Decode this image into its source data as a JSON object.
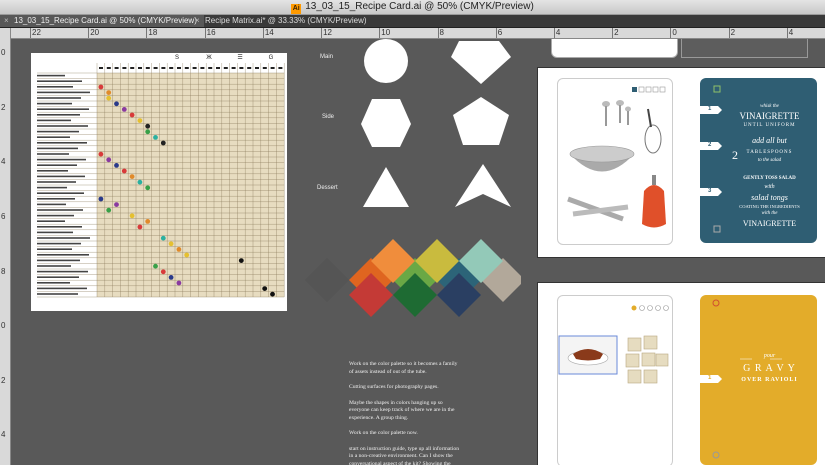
{
  "window": {
    "title": "13_03_15_Recipe Card.ai @ 50% (CMYK/Preview)",
    "app_icon": "Ai"
  },
  "tabs": [
    {
      "label": "13_03_15_Recipe Card.ai @ 50% (CMYK/Preview)",
      "close": "×",
      "active": true
    },
    {
      "label": "Recipe Matrix.ai* @ 33.33% (CMYK/Preview)",
      "close": "×",
      "active": false
    }
  ],
  "ruler_top": [
    "22",
    "20",
    "18",
    "16",
    "14",
    "12",
    "10",
    "8",
    "6",
    "4",
    "2",
    "0",
    "2",
    "4"
  ],
  "ruler_left": [
    "0",
    "2",
    "4",
    "6",
    "8",
    "0",
    "2",
    "4"
  ],
  "matrix": {
    "header_symbols": [
      "S",
      "Ж",
      "☰",
      "G"
    ],
    "dots": [
      {
        "row": 2,
        "col": 0,
        "color": "#d83a3a"
      },
      {
        "row": 3,
        "col": 1,
        "color": "#e08a2a"
      },
      {
        "row": 4,
        "col": 1,
        "color": "#e5c030"
      },
      {
        "row": 5,
        "col": 2,
        "color": "#2a3a8a"
      },
      {
        "row": 6,
        "col": 3,
        "color": "#8a3aa0"
      },
      {
        "row": 7,
        "col": 4,
        "color": "#d83a3a"
      },
      {
        "row": 8,
        "col": 5,
        "color": "#e5c030"
      },
      {
        "row": 9,
        "col": 6,
        "color": "#222222"
      },
      {
        "row": 10,
        "col": 6,
        "color": "#38a048"
      },
      {
        "row": 11,
        "col": 7,
        "color": "#2ab0a0"
      },
      {
        "row": 12,
        "col": 8,
        "color": "#222222"
      },
      {
        "row": 14,
        "col": 0,
        "color": "#d83a3a"
      },
      {
        "row": 15,
        "col": 1,
        "color": "#8a3aa0"
      },
      {
        "row": 16,
        "col": 2,
        "color": "#2a3a8a"
      },
      {
        "row": 17,
        "col": 3,
        "color": "#d83a3a"
      },
      {
        "row": 18,
        "col": 4,
        "color": "#e08a2a"
      },
      {
        "row": 19,
        "col": 5,
        "color": "#2ab0a0"
      },
      {
        "row": 20,
        "col": 6,
        "color": "#38a048"
      },
      {
        "row": 22,
        "col": 0,
        "color": "#2a3a8a"
      },
      {
        "row": 23,
        "col": 2,
        "color": "#8a3aa0"
      },
      {
        "row": 24,
        "col": 1,
        "color": "#38a048"
      },
      {
        "row": 25,
        "col": 4,
        "color": "#e5c030"
      },
      {
        "row": 26,
        "col": 6,
        "color": "#e08a2a"
      },
      {
        "row": 27,
        "col": 5,
        "color": "#d83a3a"
      },
      {
        "row": 29,
        "col": 8,
        "color": "#2ab0a0"
      },
      {
        "row": 30,
        "col": 9,
        "color": "#e5c030"
      },
      {
        "row": 31,
        "col": 10,
        "color": "#e08a2a"
      },
      {
        "row": 32,
        "col": 11,
        "color": "#e5c030"
      },
      {
        "row": 33,
        "col": 18,
        "color": "#111111"
      },
      {
        "row": 34,
        "col": 7,
        "color": "#38a048"
      },
      {
        "row": 35,
        "col": 8,
        "color": "#d83a3a"
      },
      {
        "row": 36,
        "col": 9,
        "color": "#2a3a8a"
      },
      {
        "row": 37,
        "col": 10,
        "color": "#8a3aa0"
      },
      {
        "row": 38,
        "col": 21,
        "color": "#111111"
      },
      {
        "row": 39,
        "col": 22,
        "color": "#111111"
      }
    ]
  },
  "shapes": {
    "labels": [
      "Main",
      "Side",
      "Dessert"
    ]
  },
  "palette": {
    "top_row": [
      "#f08d3c",
      "#c9bb3e",
      "#93c9b8"
    ],
    "mid_row": [
      "#555555",
      "#df6520",
      "#6aa845",
      "#2c6478",
      "#b2a89a"
    ],
    "bottom_row": [
      "#c43a36",
      "#1e6b33",
      "#2a3f62"
    ]
  },
  "notes": [
    "Work on the color palette so it becomes a family of assets instead of out of the tube.",
    "Cutting surfaces for photography pages.",
    "Maybe the shapes in colors hanging up so everyone can keep track of where we are in the experience. A group thing.",
    "Work on the color palette now.",
    "start on instruction guide, type up all information in a non-creative environment. Can I show the conversational aspect of the kit? Showing the warmth of a gathering. Can"
  ],
  "card1": {
    "panel_color": "#2f5e73",
    "steps": [
      "1",
      "2",
      "3"
    ],
    "lines": [
      "whisk the",
      "VINAIGRETTE",
      "UNTIL UNIFORM",
      "add all but",
      "2",
      "TABLESPOONS",
      "to the salad",
      "GENTLY TOSS SALAD",
      "with",
      "salad tongs",
      "COATING THE INGREDIENTS",
      "with the",
      "VINAIGRETTE"
    ]
  },
  "card2": {
    "panel_color": "#e3ac2a",
    "steps": [
      "1"
    ],
    "lines": [
      "pour",
      "G R A V Y",
      "OVER RAVIOLI"
    ]
  }
}
